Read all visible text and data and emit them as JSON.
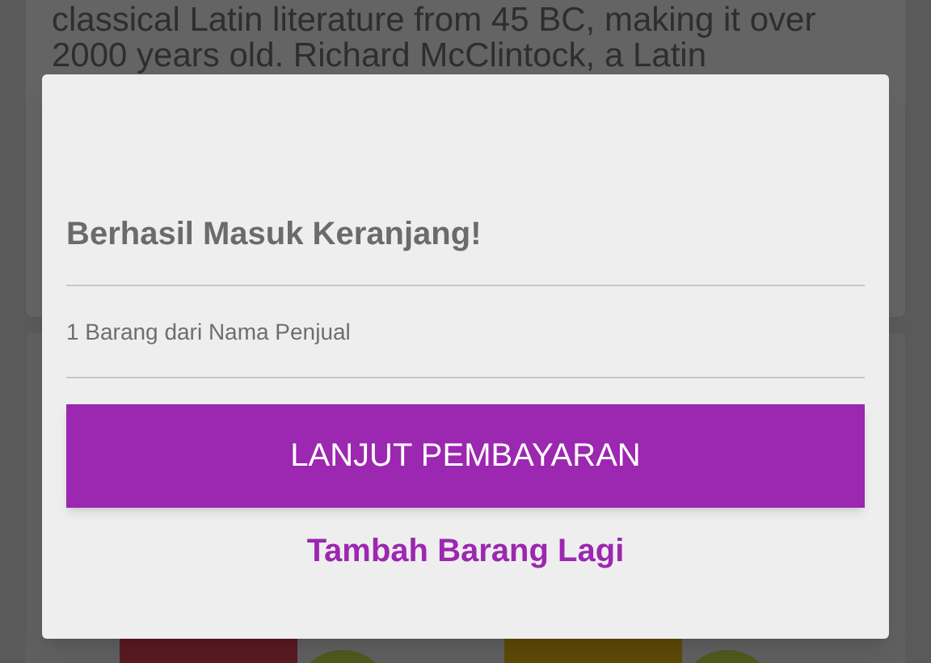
{
  "background": {
    "text_lines": [
      "classical Latin literature from 45 BC, making it over",
      "2000 years old. Richard McClintock, a Latin"
    ]
  },
  "dialog": {
    "title": "Berhasil Masuk Keranjang!",
    "message": "1 Barang dari Nama Penjual",
    "primary_button": "LANJUT PEMBAYARAN",
    "secondary_button": "Tambah Barang Lagi"
  }
}
